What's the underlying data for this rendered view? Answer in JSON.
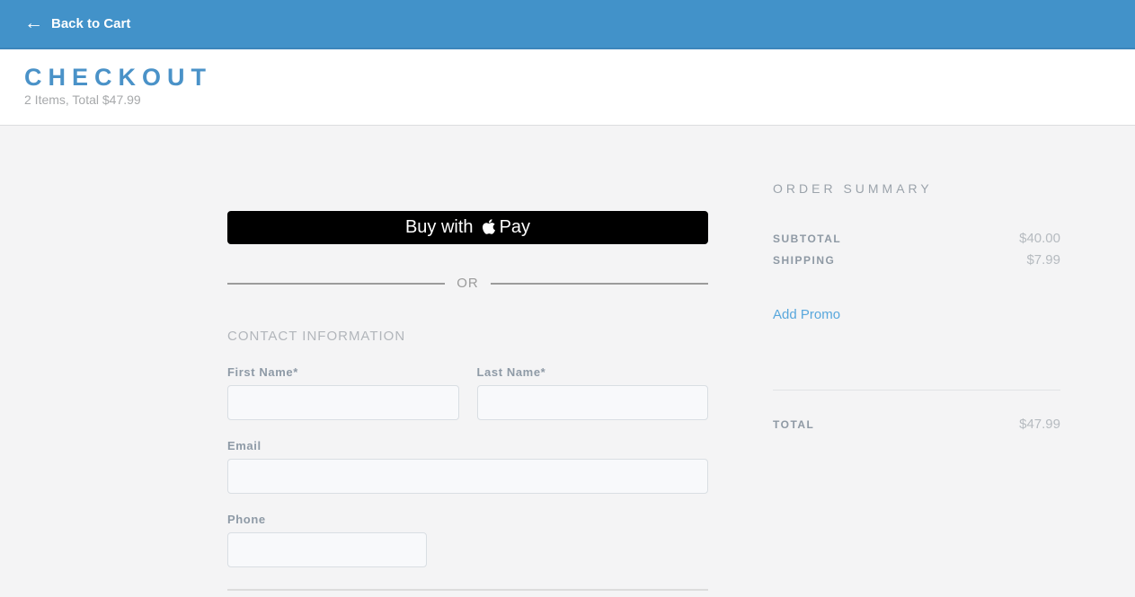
{
  "top_bar": {
    "back_label": "Back to Cart",
    "back_arrow": "←",
    "bg_color": "#4292c9"
  },
  "header": {
    "title": "CHECKOUT",
    "subtitle": "2 Items, Total $47.99",
    "title_color": "#4a92c8"
  },
  "form": {
    "apple_pay": {
      "prefix": "Buy with",
      "suffix": "Pay",
      "icon": "apple-logo-icon",
      "bg_color": "#000000"
    },
    "or_label": "OR",
    "section_title": "CONTACT INFORMATION",
    "fields": [
      {
        "id": "first-name",
        "label": "First Name*",
        "value": "",
        "placeholder": ""
      },
      {
        "id": "last-name",
        "label": "Last Name*",
        "value": "",
        "placeholder": ""
      },
      {
        "id": "email",
        "label": "Email",
        "value": "",
        "placeholder": ""
      },
      {
        "id": "phone",
        "label": "Phone",
        "value": "",
        "placeholder": ""
      }
    ]
  },
  "order_summary": {
    "title": "ORDER SUMMARY",
    "rows": [
      {
        "label": "SUBTOTAL",
        "value": "$40.00"
      },
      {
        "label": "SHIPPING",
        "value": "$7.99"
      }
    ],
    "promo_link_label": "Add Promo",
    "promo_link_color": "#58a7dc",
    "total_label": "TOTAL",
    "total_value": "$47.99"
  }
}
